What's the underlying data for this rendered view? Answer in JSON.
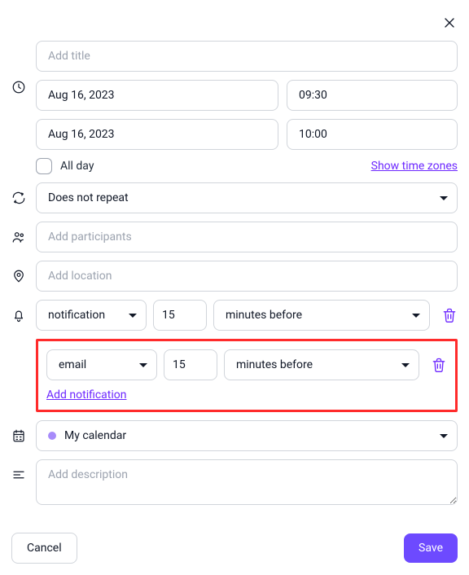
{
  "title_placeholder": "Add title",
  "dates": {
    "start_date": "Aug 16, 2023",
    "start_time": "09:30",
    "end_date": "Aug 16, 2023",
    "end_time": "10:00",
    "all_day_label": "All day",
    "show_timezones_label": "Show time zones"
  },
  "repeat": {
    "value": "Does not repeat"
  },
  "participants_placeholder": "Add participants",
  "location_placeholder": "Add location",
  "notifications": [
    {
      "type": "notification",
      "amount": "15",
      "unit": "minutes before"
    },
    {
      "type": "email",
      "amount": "15",
      "unit": "minutes before"
    }
  ],
  "add_notification_label": "Add notification",
  "calendar": {
    "name": "My calendar",
    "color": "#a78bfa"
  },
  "description_placeholder": "Add description",
  "buttons": {
    "cancel": "Cancel",
    "save": "Save"
  }
}
